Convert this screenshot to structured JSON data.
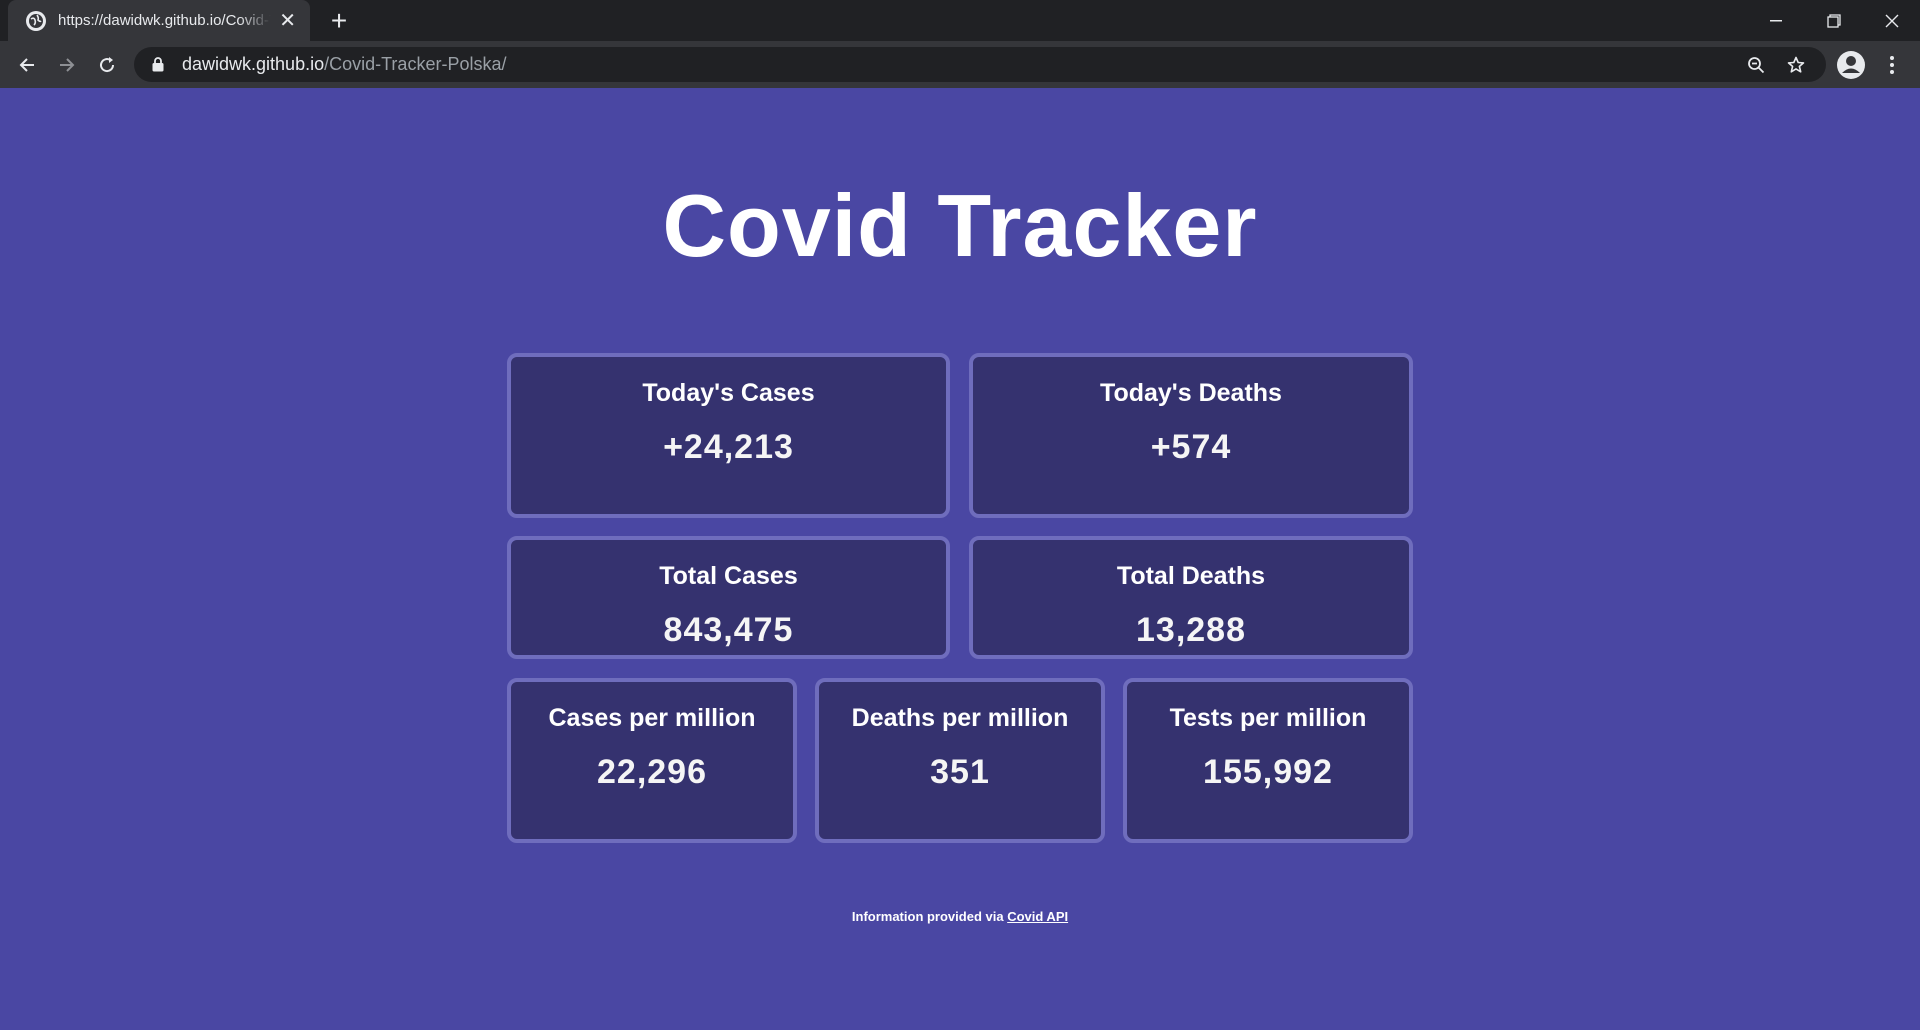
{
  "browser": {
    "tab_title": "https://dawidwk.github.io/Covid-Tracker-Polska/",
    "url_host": "dawidwk.github.io",
    "url_path": "/Covid-Tracker-Polska/"
  },
  "page": {
    "title": "Covid Tracker",
    "stats": {
      "todays_cases": {
        "label": "Today's Cases",
        "value": "+24,213"
      },
      "todays_deaths": {
        "label": "Today's Deaths",
        "value": "+574"
      },
      "total_cases": {
        "label": "Total Cases",
        "value": "843,475"
      },
      "total_deaths": {
        "label": "Total Deaths",
        "value": "13,288"
      },
      "cases_per_million": {
        "label": "Cases per million",
        "value": "22,296"
      },
      "deaths_per_million": {
        "label": "Deaths per million",
        "value": "351"
      },
      "tests_per_million": {
        "label": "Tests per million",
        "value": "155,992"
      }
    },
    "footer": {
      "text": "Information provided via ",
      "link_label": "Covid API"
    }
  },
  "colors": {
    "background": "#4a47a3",
    "card_background": "#35326f",
    "card_border": "#6f6dbd"
  }
}
